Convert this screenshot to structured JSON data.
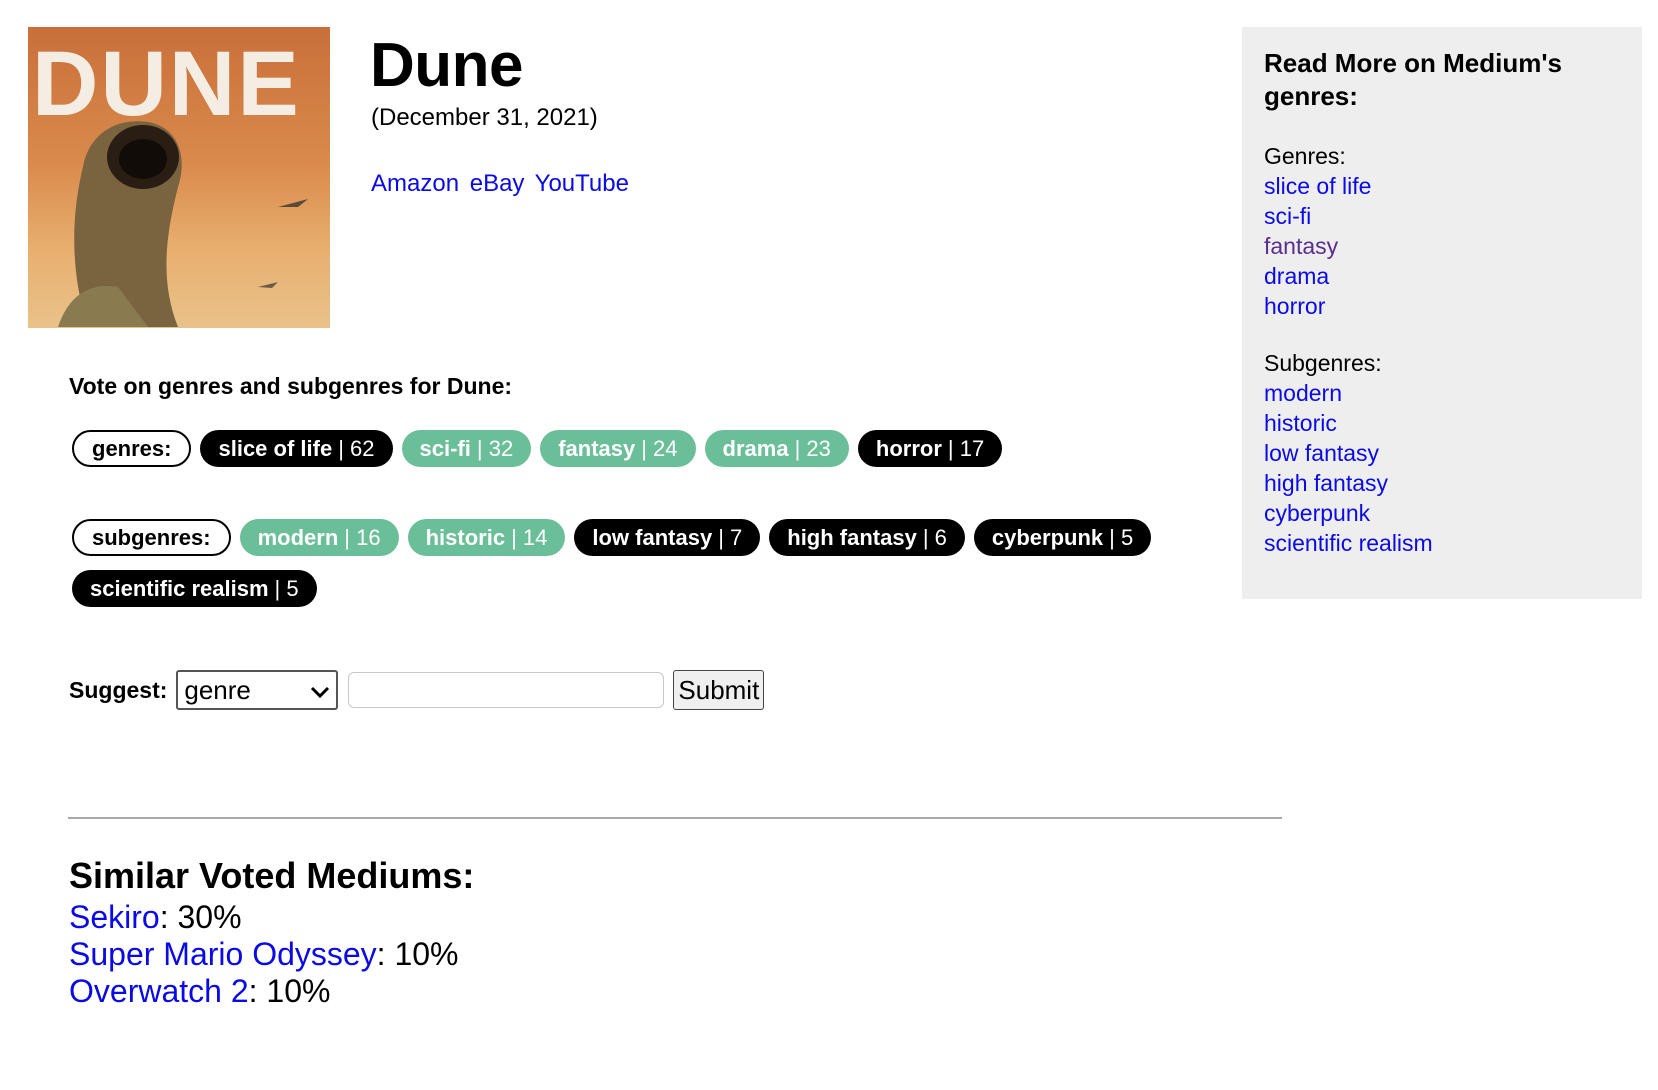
{
  "medium": {
    "title": "Dune",
    "date": "(December 31, 2021)",
    "cover_alt": "Dune book cover"
  },
  "links": [
    {
      "label": "Amazon"
    },
    {
      "label": "eBay"
    },
    {
      "label": "YouTube"
    }
  ],
  "vote": {
    "heading": "Vote on genres and subgenres for Dune:",
    "genres_label": "genres:",
    "subgenres_label": "subgenres:",
    "genres": [
      {
        "name": "slice of life",
        "count": "| 62",
        "style": "dark"
      },
      {
        "name": "sci-fi",
        "count": "| 32",
        "style": "green"
      },
      {
        "name": "fantasy",
        "count": "| 24",
        "style": "green"
      },
      {
        "name": "drama",
        "count": "| 23",
        "style": "green"
      },
      {
        "name": "horror",
        "count": "| 17",
        "style": "dark"
      }
    ],
    "subgenres": [
      {
        "name": "modern",
        "count": "| 16",
        "style": "green"
      },
      {
        "name": "historic",
        "count": "| 14",
        "style": "green"
      },
      {
        "name": "low fantasy",
        "count": "| 7",
        "style": "dark"
      },
      {
        "name": "high fantasy",
        "count": "| 6",
        "style": "dark"
      },
      {
        "name": "cyberpunk",
        "count": "| 5",
        "style": "dark"
      },
      {
        "name": "scientific realism",
        "count": "| 5",
        "style": "dark"
      }
    ]
  },
  "suggest": {
    "label": "Suggest:",
    "selected": "genre",
    "input_value": "",
    "submit_label": "Submit"
  },
  "similar": {
    "heading": "Similar Voted Mediums:",
    "items": [
      {
        "name": "Sekiro",
        "pct": ": 30%"
      },
      {
        "name": "Super Mario Odyssey",
        "pct": ": 10%"
      },
      {
        "name": "Overwatch 2",
        "pct": ": 10%"
      }
    ]
  },
  "sidebar": {
    "heading": "Read More on Medium's genres:",
    "genres_label": "Genres:",
    "genres": [
      "slice of life",
      "sci-fi",
      "fantasy",
      "drama",
      "horror"
    ],
    "subgenres_label": "Subgenres:",
    "subgenres": [
      "modern",
      "historic",
      "low fantasy",
      "high fantasy",
      "cyberpunk",
      "scientific realism"
    ]
  },
  "colors": {
    "pill_dark": "#000000",
    "pill_green": "#6bbf98",
    "link": "#0a0ae6",
    "visited_link": "#5a2e8c",
    "sidebar_bg": "#eeeeee"
  }
}
